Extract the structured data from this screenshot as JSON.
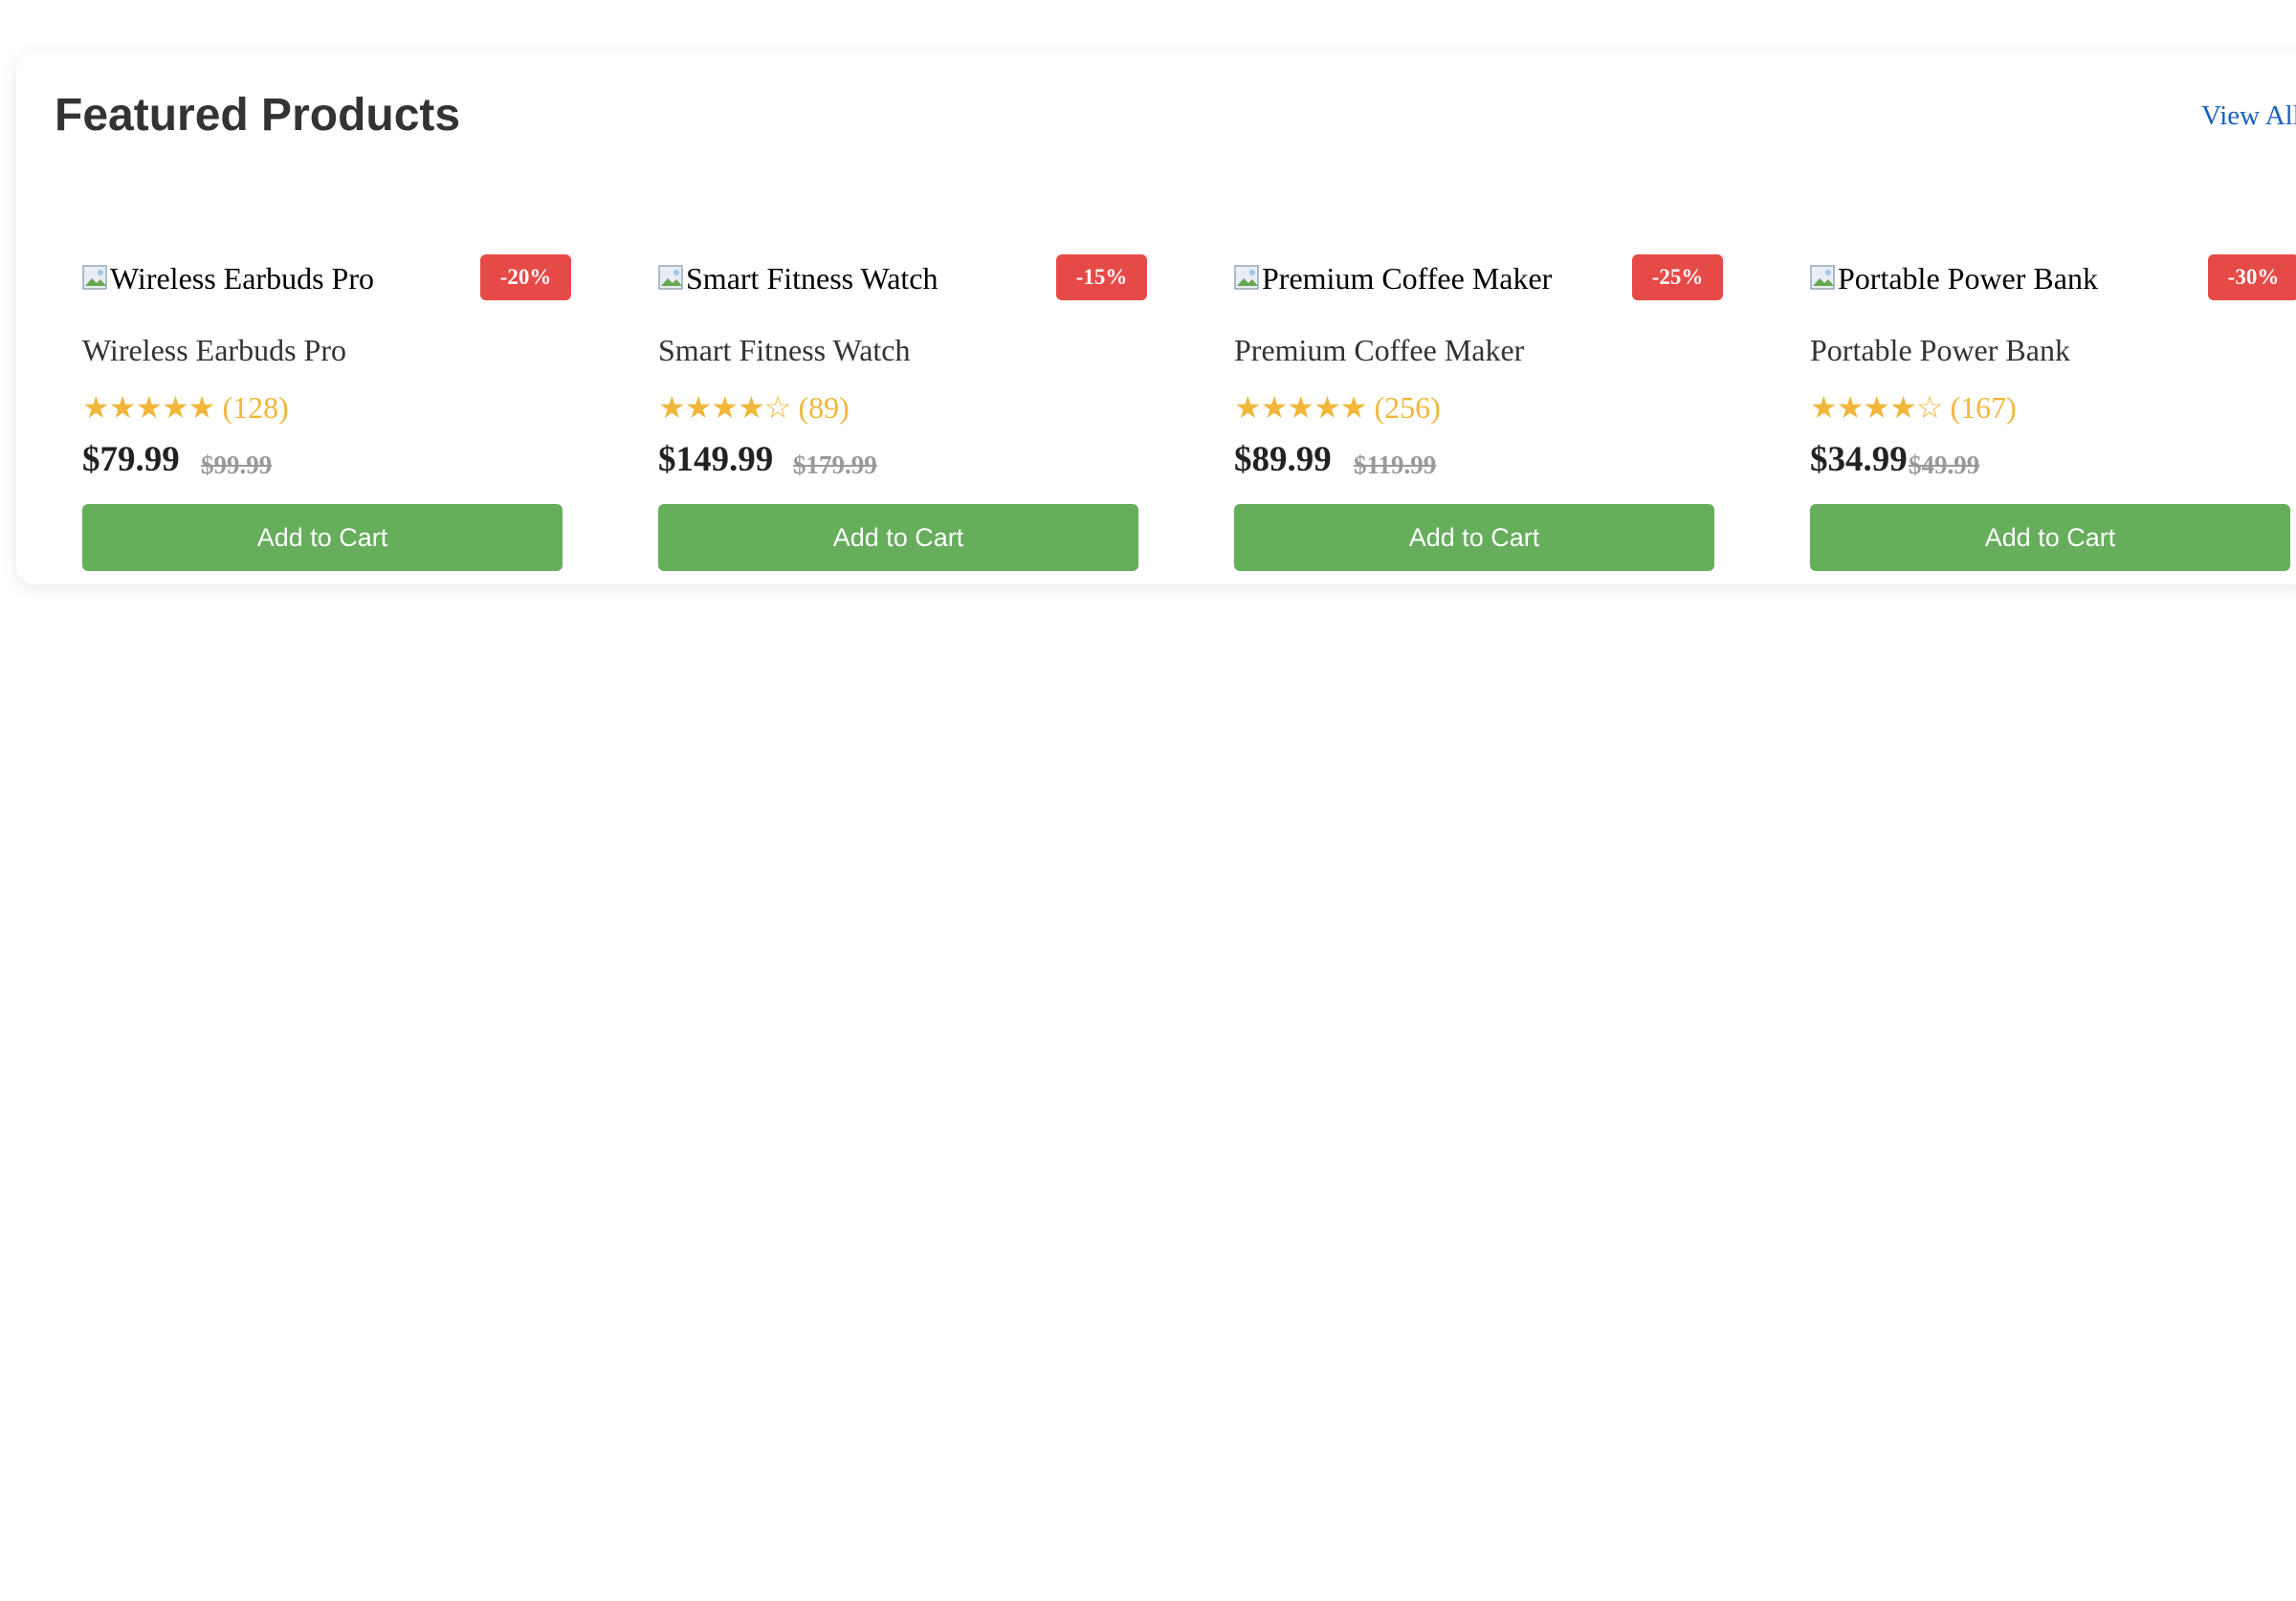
{
  "section": {
    "title": "Featured Products",
    "view_all_label": "View All"
  },
  "products": [
    {
      "image_alt": "Wireless Earbuds Pro",
      "name": "Wireless Earbuds Pro",
      "discount": "-20%",
      "stars": "★★★★★",
      "rating_value": 5,
      "review_count": "(128)",
      "price": "$79.99",
      "old_price": "$99.99",
      "cta": "Add to Cart"
    },
    {
      "image_alt": "Smart Fitness Watch",
      "name": "Smart Fitness Watch",
      "discount": "-15%",
      "stars": "★★★★☆",
      "rating_value": 4,
      "review_count": "(89)",
      "price": "$149.99",
      "old_price": "$179.99",
      "cta": "Add to Cart"
    },
    {
      "image_alt": "Premium Coffee Maker",
      "name": "Premium Coffee Maker",
      "discount": "-25%",
      "stars": "★★★★★",
      "rating_value": 5,
      "review_count": "(256)",
      "price": "$89.99",
      "old_price": "$119.99",
      "cta": "Add to Cart"
    },
    {
      "image_alt": "Portable Power Bank",
      "name": "Portable Power Bank",
      "discount": "-30%",
      "stars": "★★★★☆",
      "rating_value": 4,
      "review_count": "(167)",
      "price": "$34.99",
      "old_price": "$49.99",
      "cta": "Add to Cart"
    }
  ],
  "colors": {
    "title": "#333333",
    "link": "#1a5fc2",
    "badge": "#e64a47",
    "stars": "#f0b73b",
    "button": "#66ad5c",
    "price": "#222222",
    "old_price": "#999999"
  },
  "icons": {
    "product_image": "broken-image-icon",
    "rating": "star-icon"
  }
}
